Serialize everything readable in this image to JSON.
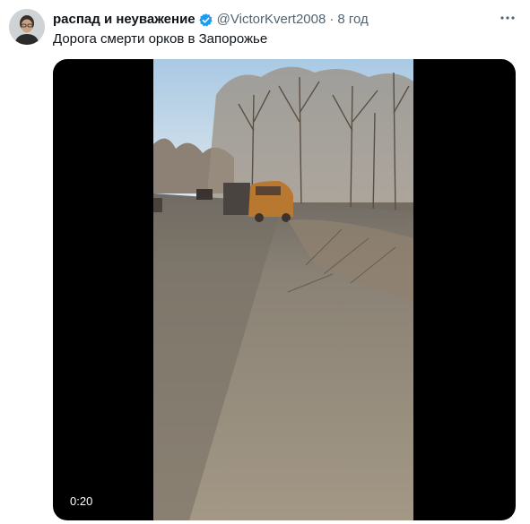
{
  "tweet": {
    "author_name": "распад и неуважение",
    "handle": "@VictorKvert2008",
    "separator": "·",
    "time": "8 год",
    "text": "Дорога смерти орков в Запорожье",
    "verified": true
  },
  "media": {
    "duration": "0:20"
  },
  "icons": {
    "verified": "verified-badge-icon",
    "more": "more-dots-icon"
  },
  "colors": {
    "verified_blue": "#1d9bf0",
    "secondary_text": "#536471",
    "primary_text": "#0f1419"
  }
}
